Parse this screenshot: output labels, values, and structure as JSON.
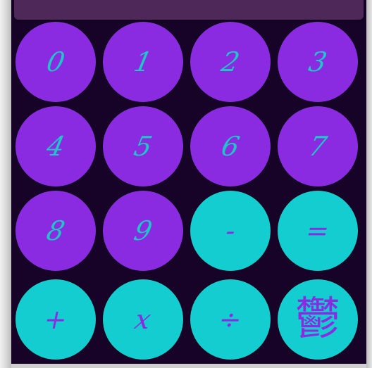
{
  "display": {
    "value": ""
  },
  "keys": [
    {
      "label": "0",
      "kind": "digit"
    },
    {
      "label": "1",
      "kind": "digit"
    },
    {
      "label": "2",
      "kind": "digit"
    },
    {
      "label": "3",
      "kind": "digit"
    },
    {
      "label": "4",
      "kind": "digit"
    },
    {
      "label": "5",
      "kind": "digit"
    },
    {
      "label": "6",
      "kind": "digit"
    },
    {
      "label": "7",
      "kind": "digit"
    },
    {
      "label": "8",
      "kind": "digit"
    },
    {
      "label": "9",
      "kind": "digit"
    },
    {
      "label": "-",
      "kind": "op"
    },
    {
      "label": "=",
      "kind": "op"
    },
    {
      "label": "+",
      "kind": "op"
    },
    {
      "label": "x",
      "kind": "op"
    },
    {
      "label": "÷",
      "kind": "op"
    },
    {
      "label": "鬱",
      "kind": "clear"
    }
  ],
  "colors": {
    "digit_key": "#8a2be2",
    "digit_text": "#1ec6c8",
    "op_key": "#14cdd0",
    "op_text": "#8a2be2",
    "panel": "#170228",
    "display": "#4e2859"
  }
}
